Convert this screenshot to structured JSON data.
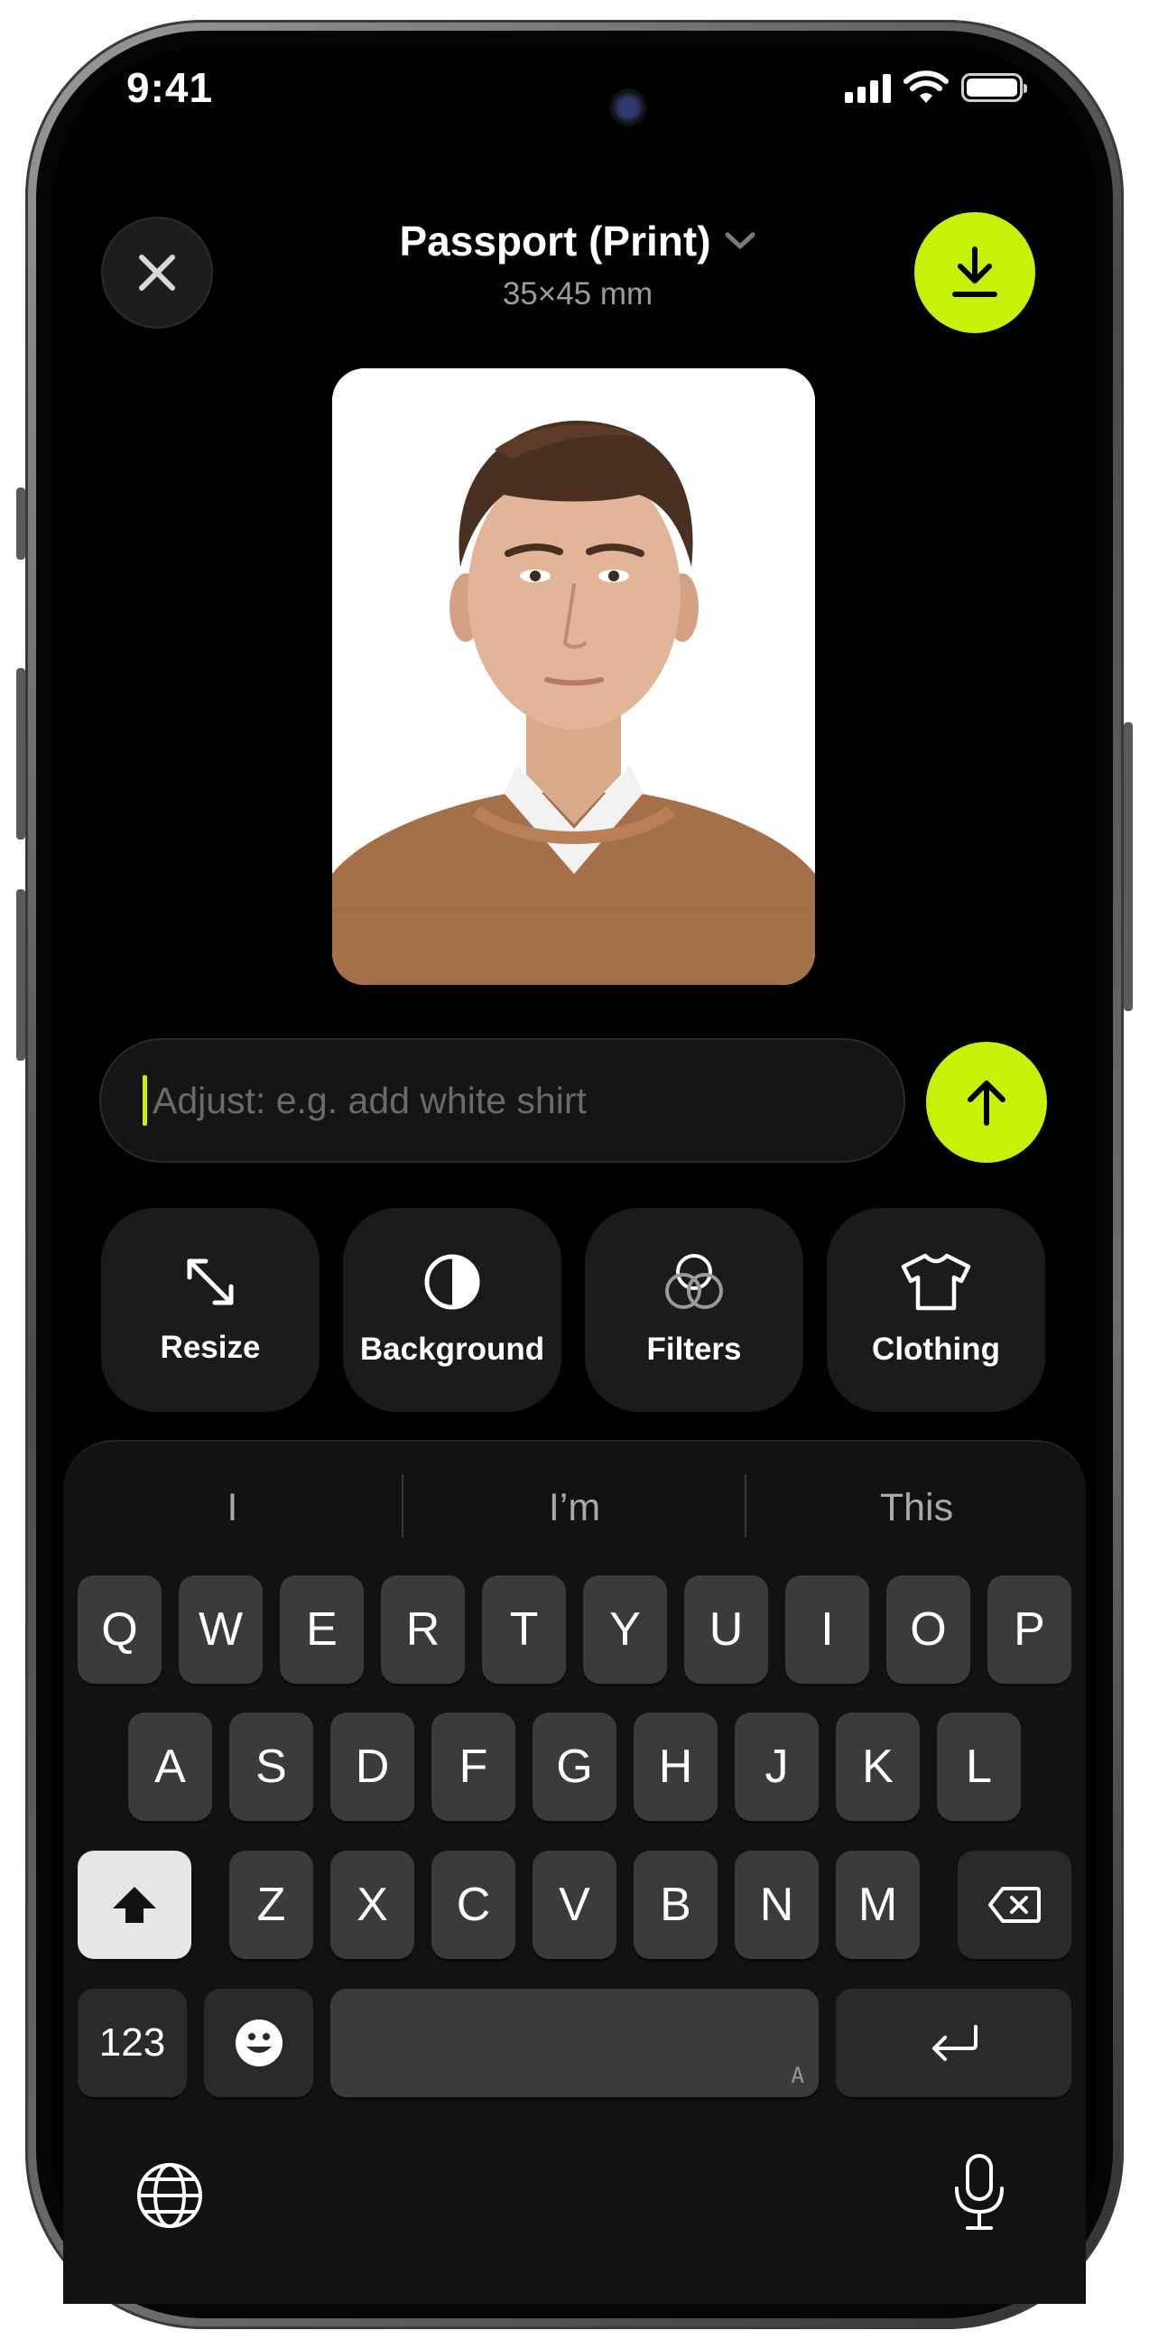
{
  "status_bar": {
    "time": "9:41",
    "icons": [
      "cellular-signal-icon",
      "wifi-icon",
      "battery-icon"
    ]
  },
  "header": {
    "title": "Passport (Print)",
    "subtitle": "35×45 mm"
  },
  "adjust": {
    "placeholder": "Adjust: e.g. add white shirt",
    "value": ""
  },
  "tools": [
    {
      "label": "Resize",
      "icon": "resize-icon"
    },
    {
      "label": "Background",
      "icon": "contrast-icon"
    },
    {
      "label": "Filters",
      "icon": "filters-icon"
    },
    {
      "label": "Clothing",
      "icon": "tshirt-icon"
    }
  ],
  "keyboard": {
    "suggestions": [
      "I",
      "I’m",
      "This"
    ],
    "row1": [
      "Q",
      "W",
      "E",
      "R",
      "T",
      "Y",
      "U",
      "I",
      "O",
      "P"
    ],
    "row2": [
      "A",
      "S",
      "D",
      "F",
      "G",
      "H",
      "J",
      "K",
      "L"
    ],
    "row3": [
      "Z",
      "X",
      "C",
      "V",
      "B",
      "N",
      "M"
    ],
    "numbers_key": "123",
    "space_hint": "A"
  },
  "colors": {
    "accent": "#c6f20a",
    "background": "#000000",
    "key": "#3b3b3b",
    "sweater": "#a4704a"
  }
}
